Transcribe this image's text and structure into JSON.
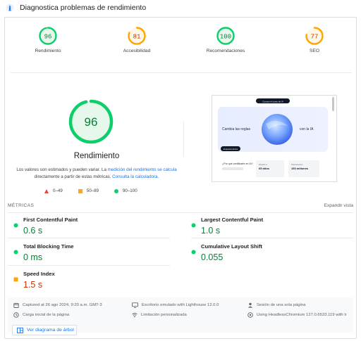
{
  "header": {
    "title": "Diagnostica problemas de rendimiento",
    "icon": "lighthouse-icon"
  },
  "colors": {
    "good": "#0cce6b",
    "good_text": "#0a7d37",
    "average": "#ffa400",
    "poor": "#ff4e42",
    "link": "#1a73e8"
  },
  "summary_gauges": [
    {
      "score": 96,
      "label": "Rendimiento",
      "color": "#0cce6b"
    },
    {
      "score": 81,
      "label": "Accesibilidad",
      "color": "#ffa400"
    },
    {
      "score": 100,
      "label": "Recomendaciones",
      "color": "#0cce6b"
    },
    {
      "score": 77,
      "label": "SEO",
      "color": "#ffa400"
    }
  ],
  "main_gauge": {
    "score": 96,
    "label": "Rendimiento",
    "color": "#0cce6b"
  },
  "note": {
    "text_1": "Los valores son estimados y pueden variar. La ",
    "link_1": "medición del rendimiento se calcula",
    "text_2": " directamente a partir de estas métricas. ",
    "link_2": "Consulta la calculadora."
  },
  "legend": [
    {
      "range": "0–49",
      "shape": "triangle"
    },
    {
      "range": "50–89",
      "shape": "square"
    },
    {
      "range": "90–100",
      "shape": "circle"
    }
  ],
  "screenshot_preview": {
    "nav_pill": "Conoce el curso de IA",
    "hero_left": "Cambia las reglas",
    "hero_right": "con la IA",
    "button": "Empieza ahora",
    "card_question": "¿Por qué certificarte en IA?",
    "stat_1_label": "Dirigido a",
    "stat_1_value": "65 años",
    "stat_2_label": "Participantes",
    "stat_2_value": "153 millones"
  },
  "metrics": {
    "heading": "MÉTRICAS",
    "expand": "Expandir vista",
    "items": [
      {
        "name": "First Contentful Paint",
        "value": "0.6 s",
        "status": "good"
      },
      {
        "name": "Largest Contentful Paint",
        "value": "1.0 s",
        "status": "good"
      },
      {
        "name": "Total Blocking Time",
        "value": "0 ms",
        "status": "good"
      },
      {
        "name": "Cumulative Layout Shift",
        "value": "0.055",
        "status": "good"
      },
      {
        "name": "Speed Index",
        "value": "1.5 s",
        "status": "average"
      }
    ]
  },
  "run_info": {
    "captured": "Captured at 26 ago 2024, 9:20 a.m. GMT-3",
    "device": "Escritorio emulado with Lighthouse 12.0.0",
    "session": "Sesión de una sola página",
    "load": "Carga inicial de la página",
    "throttling": "Limitación personalizada",
    "browser": "Using HeadlessChromium 127.0.6533.119 with lr"
  },
  "treemap_button": "Ver diagrama de árbol"
}
